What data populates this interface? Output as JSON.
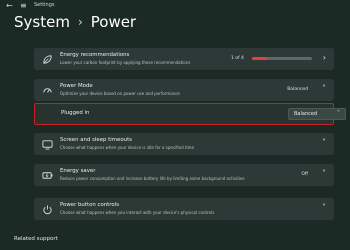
{
  "window": {
    "title": "Settings",
    "back_glyph": "←",
    "menu_glyph": "≡"
  },
  "breadcrumb": {
    "root": "System",
    "sep": "›",
    "current": "Power"
  },
  "energy": {
    "title": "Energy recommendations",
    "desc": "Lower your carbon footprint by applying these recommendations",
    "pager": "1 of 4",
    "progress": 0.25,
    "icon": "leaf-icon"
  },
  "power_mode": {
    "title": "Power Mode",
    "desc": "Optimize your device based on power use and performance",
    "value": "Balanced",
    "icon": "power-mode-icon"
  },
  "plugged_in": {
    "label": "Plugged in",
    "selected": "Balanced",
    "highlight_color": "#cc1f1f"
  },
  "screen_sleep": {
    "title": "Screen and sleep timeouts",
    "desc": "Choose what happens when your device is idle for a specified time",
    "icon": "screen-sleep-icon"
  },
  "energy_saver": {
    "title": "Energy saver",
    "desc": "Reduce power consumption and increase battery life by limiting some background activities",
    "value": "Off",
    "icon": "energy-saver-icon"
  },
  "power_button": {
    "title": "Power button controls",
    "desc": "Choose what happens when you interact with your device's physical controls",
    "icon": "power-button-icon"
  },
  "related": {
    "label": "Related support"
  },
  "colors": {
    "accent_red": "#e0423b",
    "background": "#1c2a26",
    "card": "#2c3936"
  }
}
